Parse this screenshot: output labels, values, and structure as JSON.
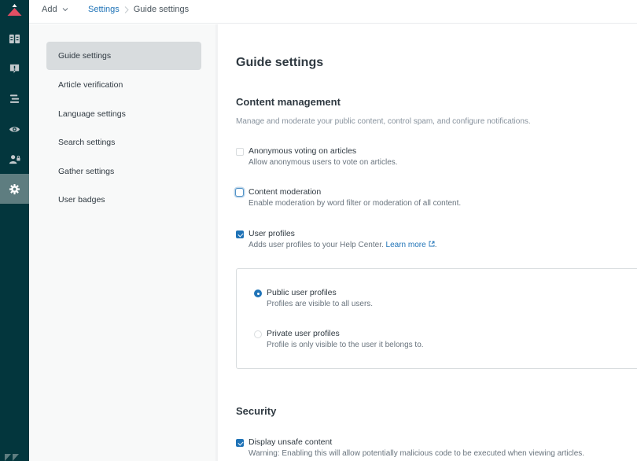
{
  "header": {
    "add_label": "Add",
    "breadcrumb": {
      "parent": "Settings",
      "current": "Guide settings"
    }
  },
  "rail": {
    "items": [
      {
        "name": "knowledge-base",
        "icon": "book-icon"
      },
      {
        "name": "community",
        "icon": "community-alert-icon"
      },
      {
        "name": "arrange-content",
        "icon": "layout-lines-icon"
      },
      {
        "name": "preview",
        "icon": "eye-icon"
      },
      {
        "name": "user-permissions",
        "icon": "user-lock-icon"
      },
      {
        "name": "settings",
        "icon": "gear-icon",
        "active": true
      }
    ]
  },
  "sidebar": {
    "items": [
      {
        "label": "Guide settings",
        "active": true
      },
      {
        "label": "Article verification"
      },
      {
        "label": "Language settings"
      },
      {
        "label": "Search settings"
      },
      {
        "label": "Gather settings"
      },
      {
        "label": "User badges"
      }
    ]
  },
  "main": {
    "title": "Guide settings",
    "content_management": {
      "title": "Content management",
      "description": "Manage and moderate your public content, control spam, and configure notifications.",
      "options": [
        {
          "label": "Anonymous voting on articles",
          "hint": "Allow anonymous users to vote on articles.",
          "checked": false
        },
        {
          "label": "Content moderation",
          "hint": "Enable moderation by word filter or moderation of all content.",
          "checked": false,
          "focused": true
        },
        {
          "label": "User profiles",
          "hint": "Adds user profiles to your Help Center.",
          "link": "Learn more",
          "hint_suffix": ".",
          "checked": true
        }
      ],
      "profile_visibility": [
        {
          "label": "Public user profiles",
          "hint": "Profiles are visible to all users.",
          "selected": true
        },
        {
          "label": "Private user profiles",
          "hint": "Profile is only visible to the user it belongs to.",
          "selected": false
        }
      ]
    },
    "security": {
      "title": "Security",
      "options": [
        {
          "label": "Display unsafe content",
          "hint": "Warning: Enabling this will allow potentially malicious code to be executed when viewing articles.",
          "checked": true
        }
      ]
    }
  },
  "colors": {
    "rail_bg": "#03363d",
    "rail_active": "#5e7d80",
    "accent": "#1f73b7",
    "logo_red": "#e34f64"
  }
}
